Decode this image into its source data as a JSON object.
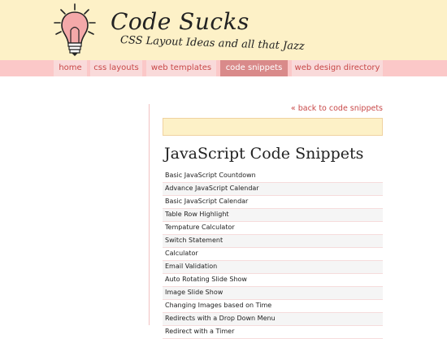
{
  "site": {
    "title": "Code Sucks",
    "tagline": "CSS Layout Ideas and all that Jazz"
  },
  "nav": {
    "items": [
      {
        "label": "home"
      },
      {
        "label": "css layouts"
      },
      {
        "label": "web templates"
      },
      {
        "label": "code snippets",
        "active": true
      },
      {
        "label": "web design directory"
      }
    ]
  },
  "content": {
    "back_link": "« back to code snippets",
    "heading": "JavaScript Code Snippets",
    "snippets": [
      "Basic JavaScript Countdown",
      "Advance JavaScript Calendar",
      "Basic JavaScript Calendar",
      "Table Row Highlight",
      "Tempature Calculator",
      "Switch Statement",
      "Calculator",
      "Email Validation",
      "Auto Rotating Slide Show",
      "Image Slide Show",
      "Changing Images based on Time",
      "Redirects with a Drop Down Menu",
      "Redirect with a Timer"
    ]
  },
  "colors": {
    "header_bg": "#fdf1c7",
    "nav_bg": "#fbc8c8",
    "nav_item_bg": "#f9dada",
    "nav_active_bg": "#d98a8a",
    "link_color": "#c84848"
  }
}
